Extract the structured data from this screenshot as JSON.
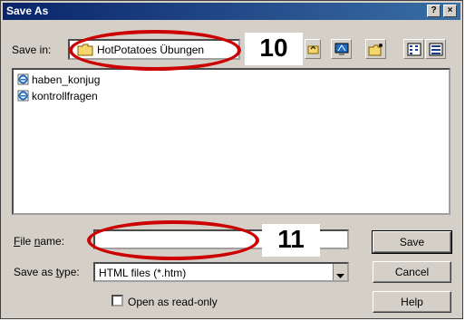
{
  "window": {
    "title": "Save As",
    "help_glyph": "?",
    "close_glyph": "×"
  },
  "save_in": {
    "label": "Save in:",
    "folder": "HotPotatoes Übungen"
  },
  "toolbar": {
    "icons": [
      "up-folder-icon",
      "desktop-icon",
      "new-folder-icon",
      "list-view-icon",
      "details-view-icon"
    ]
  },
  "files": [
    "haben_konjug",
    "kontrollfragen"
  ],
  "file_name": {
    "label": "File name:",
    "value": ""
  },
  "save_as_type": {
    "label": "Save as type:",
    "value": "HTML files (*.htm)"
  },
  "open_readonly": {
    "label": "Open as read-only",
    "checked": false
  },
  "buttons": {
    "save": "Save",
    "cancel": "Cancel",
    "help": "Help"
  },
  "annotations": {
    "first": "10",
    "second": "11"
  },
  "colors": {
    "annotation_red": "#cc0000",
    "titlebar": "#0a246a"
  }
}
